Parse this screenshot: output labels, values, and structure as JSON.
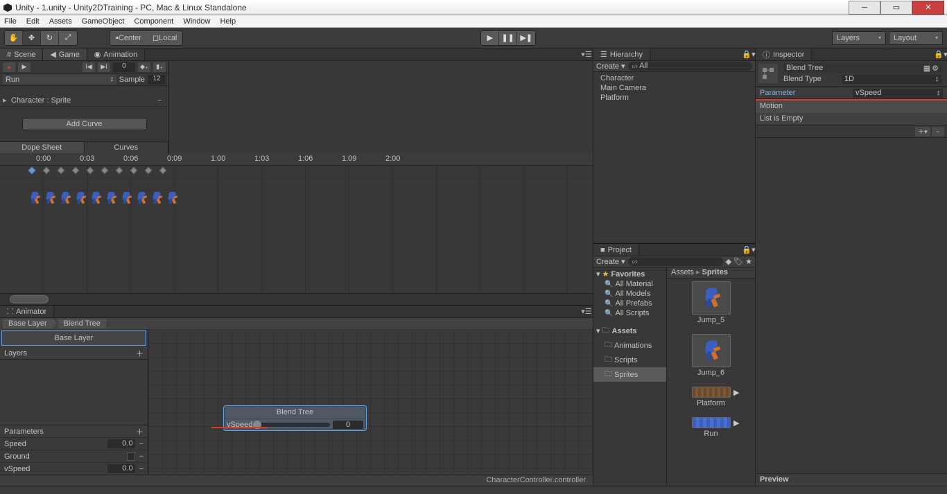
{
  "window": {
    "title": "Unity - 1.unity - Unity2DTraining - PC, Mac & Linux Standalone"
  },
  "menubar": [
    "File",
    "Edit",
    "Assets",
    "GameObject",
    "Component",
    "Window",
    "Help"
  ],
  "toolbar": {
    "pivot": "Center",
    "space": "Local",
    "layers": "Layers",
    "layout": "Layout"
  },
  "tabs_left_top": [
    "Scene",
    "Game",
    "Animation"
  ],
  "animation": {
    "clip": "Run",
    "sample_label": "Sample",
    "sample": "12",
    "frame": "0",
    "prop": "Character : Sprite",
    "add_curve": "Add Curve",
    "bottom_tabs": [
      "Dope Sheet",
      "Curves"
    ],
    "timeline_ticks": [
      "0:00",
      "0:03",
      "0:06",
      "0:09",
      "1:00",
      "1:03",
      "1:06",
      "1:09",
      "2:00"
    ]
  },
  "animator": {
    "tab": "Animator",
    "crumbs": [
      "Base Layer",
      "Blend Tree"
    ],
    "layer": "Base Layer",
    "layers_label": "Layers",
    "parameters_label": "Parameters",
    "params": [
      {
        "name": "Speed",
        "value": "0.0",
        "type": "float"
      },
      {
        "name": "Ground",
        "value": "",
        "type": "bool"
      },
      {
        "name": "vSpeed",
        "value": "0.0",
        "type": "float"
      }
    ],
    "node": {
      "title": "Blend Tree",
      "param": "vSpeed",
      "value": "0"
    },
    "footer": "CharacterController.controller"
  },
  "hierarchy": {
    "tab": "Hierarchy",
    "create": "Create",
    "search_hint": "All",
    "items": [
      "Character",
      "Main Camera",
      "Platform"
    ]
  },
  "project": {
    "tab": "Project",
    "create": "Create",
    "crumbs": [
      "Assets",
      "Sprites"
    ],
    "favorites_label": "Favorites",
    "favorites": [
      "All Material",
      "All Models",
      "All Prefabs",
      "All Scripts"
    ],
    "assets_label": "Assets",
    "folders": [
      "Animations",
      "Scripts",
      "Sprites"
    ],
    "grid": [
      "Jump_5",
      "Jump_6",
      "Platform",
      "Run"
    ]
  },
  "inspector": {
    "tab": "Inspector",
    "name": "Blend Tree",
    "blend_type_label": "Blend Type",
    "blend_type": "1D",
    "parameter_label": "Parameter",
    "parameter": "vSpeed",
    "motion_label": "Motion",
    "empty": "List is Empty",
    "preview": "Preview"
  }
}
